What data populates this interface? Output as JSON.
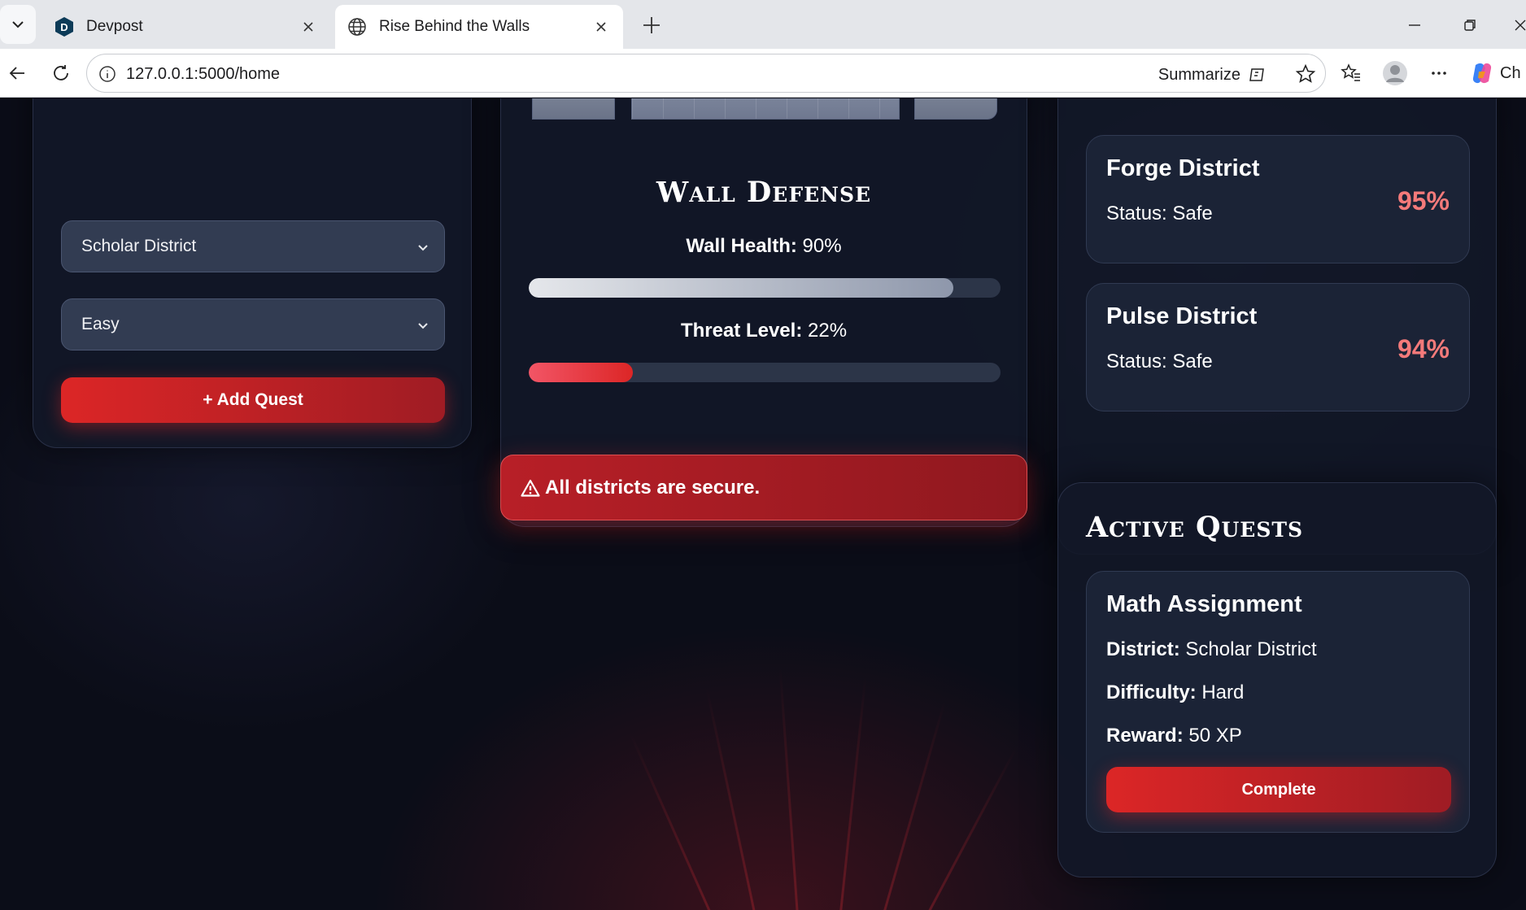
{
  "browser": {
    "tabs": [
      {
        "title": "Devpost",
        "favicon_letter": "D",
        "active": false
      },
      {
        "title": "Rise Behind the Walls",
        "active": true
      }
    ],
    "url": "127.0.0.1:5000/home",
    "summarize_label": "Summarize",
    "copilot_partial": "Ch"
  },
  "quest_form": {
    "district_value": "Scholar District",
    "difficulty_value": "Easy",
    "add_button": "+ Add Quest"
  },
  "wall_defense": {
    "title": "Wall Defense",
    "health_label": "Wall Health:",
    "health_value": "90%",
    "health_fraction": 0.9,
    "threat_label": "Threat Level:",
    "threat_value": "22%",
    "threat_fraction": 0.22
  },
  "alert": {
    "icon": "warning-icon",
    "text": "All districts are secure."
  },
  "districts": [
    {
      "name": "Forge District",
      "status": "Status: Safe",
      "percent": "95%"
    },
    {
      "name": "Pulse District",
      "status": "Status: Safe",
      "percent": "94%"
    }
  ],
  "active_quests": {
    "title": "Active Quests",
    "quest": {
      "name": "Math Assignment",
      "district_label": "District:",
      "district_value": "Scholar District",
      "difficulty_label": "Difficulty:",
      "difficulty_value": "Hard",
      "reward_label": "Reward:",
      "reward_value": "50 XP",
      "complete_button": "Complete"
    }
  },
  "colors": {
    "accent_red": "#dc2626",
    "percent_pink": "#f47a7a",
    "card_bg": "#121828"
  }
}
